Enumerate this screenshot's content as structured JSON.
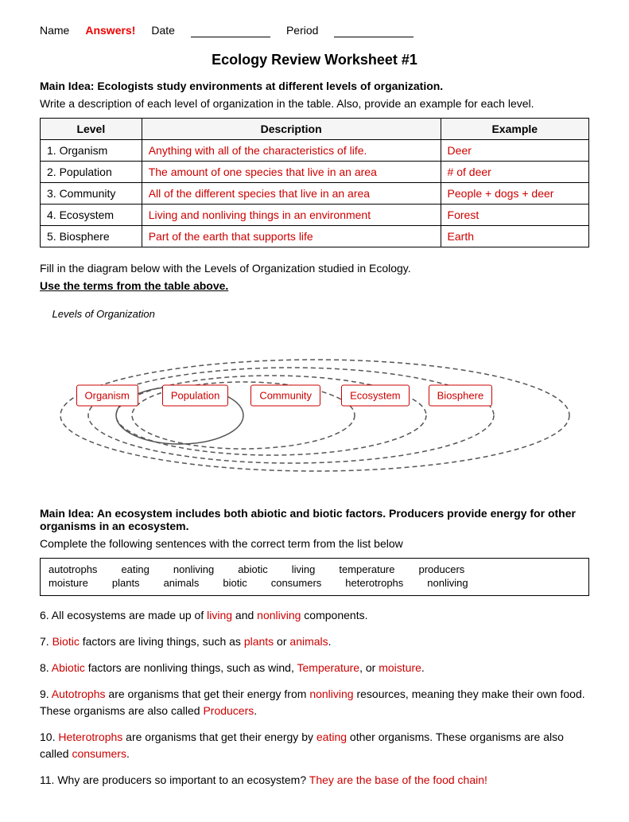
{
  "header": {
    "name_label": "Name",
    "answers_label": "Answers!",
    "date_label": "Date",
    "period_label": "Period"
  },
  "title": "Ecology Review Worksheet #1",
  "section1": {
    "main_idea": "Main Idea:  Ecologists study environments at different levels of organization.",
    "subtitle": "Write a description of each level of organization in the table.  Also, provide an example for each level.",
    "table": {
      "headers": [
        "Level",
        "Description",
        "Example"
      ],
      "rows": [
        {
          "level": "1. Organism",
          "description": "Anything with all of the characteristics of life.",
          "example": "Deer"
        },
        {
          "level": "2. Population",
          "description": "The amount of one species that live in an area",
          "example": "# of deer"
        },
        {
          "level": "3. Community",
          "description": "All of the different species that live in an area",
          "example": "People + dogs  + deer"
        },
        {
          "level": "4. Ecosystem",
          "description": "Living and nonliving things in an environment",
          "example": "Forest"
        },
        {
          "level": "5. Biosphere",
          "description": "Part of the earth that supports life",
          "example": "Earth"
        }
      ]
    }
  },
  "venn": {
    "instruction": "Fill in the diagram below with the Levels of Organization studied in Ecology.",
    "use_terms": "Use the terms from the table above.",
    "diagram_label": "Levels of Organization",
    "terms": [
      "Organism",
      "Population",
      "Community",
      "Ecosystem",
      "Biosphere"
    ]
  },
  "section2": {
    "main_idea": "Main Idea:  An ecosystem includes both abiotic and biotic factors.  Producers provide energy for other organisms in an ecosystem.",
    "subtitle": "Complete the following sentences with the correct term from the list below",
    "terms_row1": [
      "autotrophs",
      "eating",
      "nonliving",
      "abiotic",
      "living",
      "temperature",
      "producers"
    ],
    "terms_row2": [
      "moisture",
      "plants",
      "animals",
      "biotic",
      "consumers",
      "heterotrophs",
      "nonliving"
    ],
    "sentences": [
      {
        "number": "6.",
        "parts": [
          {
            "text": "All ecosystems are made up of ",
            "red": false
          },
          {
            "text": "living",
            "red": true
          },
          {
            "text": " and ",
            "red": false
          },
          {
            "text": "nonliving",
            "red": true
          },
          {
            "text": " components.",
            "red": false
          }
        ]
      },
      {
        "number": "7.",
        "parts": [
          {
            "text": "Biotic",
            "red": true
          },
          {
            "text": " factors are living things, such as ",
            "red": false
          },
          {
            "text": "plants",
            "red": true
          },
          {
            "text": " or ",
            "red": false
          },
          {
            "text": "animals",
            "red": true
          },
          {
            "text": ".",
            "red": false
          }
        ]
      },
      {
        "number": "8.",
        "parts": [
          {
            "text": "Abiotic",
            "red": true
          },
          {
            "text": " factors are nonliving things, such as wind, ",
            "red": false
          },
          {
            "text": "Temperature",
            "red": true
          },
          {
            "text": ", or ",
            "red": false
          },
          {
            "text": "moisture",
            "red": true
          },
          {
            "text": ".",
            "red": false
          }
        ]
      },
      {
        "number": "9.",
        "parts": [
          {
            "text": "Autotrophs",
            "red": true
          },
          {
            "text": " are organisms that get their energy from ",
            "red": false
          },
          {
            "text": "nonliving",
            "red": true
          },
          {
            "text": " resources, meaning they make their own food.  These organisms are also called ",
            "red": false
          },
          {
            "text": "Producers",
            "red": true
          },
          {
            "text": ".",
            "red": false
          }
        ]
      },
      {
        "number": "10.",
        "parts": [
          {
            "text": "Heterotrophs",
            "red": true
          },
          {
            "text": " are organisms that get their energy by ",
            "red": false
          },
          {
            "text": "eating",
            "red": true
          },
          {
            "text": " other organisms.  These organisms are also called ",
            "red": false
          },
          {
            "text": "consumers",
            "red": true
          },
          {
            "text": ".",
            "red": false
          }
        ]
      },
      {
        "number": "11.",
        "parts": [
          {
            "text": "Why are producers so important to an ecosystem? ",
            "red": false
          },
          {
            "text": "They are the base of the food chain!",
            "red": true
          }
        ]
      }
    ]
  }
}
